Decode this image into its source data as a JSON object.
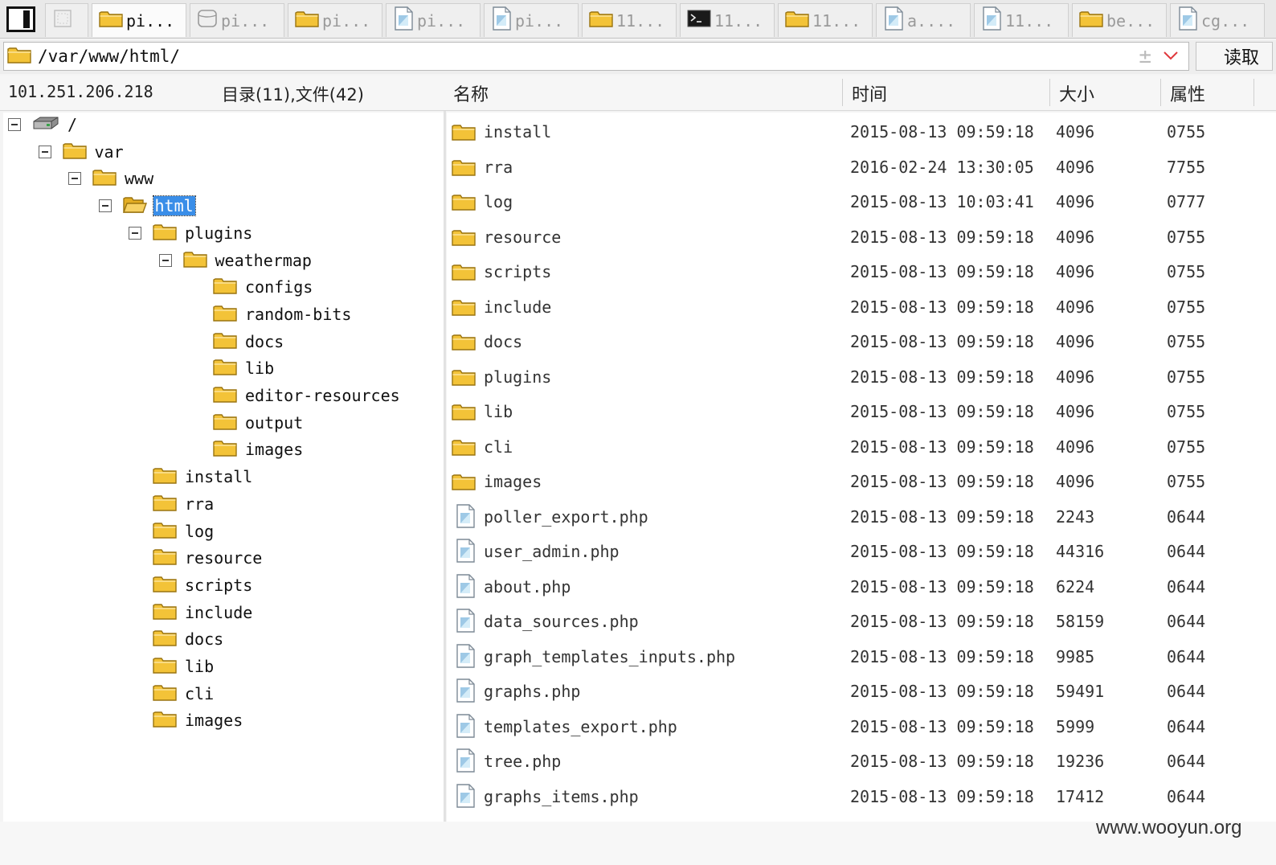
{
  "tabs": [
    {
      "label": "",
      "icon": "blank-tab-icon",
      "active": false
    },
    {
      "label": "pi...",
      "icon": "folder-icon",
      "active": true
    },
    {
      "label": "pi...",
      "icon": "database-icon",
      "active": false
    },
    {
      "label": "pi...",
      "icon": "folder-icon",
      "active": false
    },
    {
      "label": "pi...",
      "icon": "file-icon",
      "active": false
    },
    {
      "label": "pi...",
      "icon": "file-icon",
      "active": false
    },
    {
      "label": "11...",
      "icon": "folder-icon",
      "active": false
    },
    {
      "label": "11...",
      "icon": "terminal-icon",
      "active": false
    },
    {
      "label": "11...",
      "icon": "folder-icon",
      "active": false
    },
    {
      "label": "a....",
      "icon": "file-icon",
      "active": false
    },
    {
      "label": "11...",
      "icon": "file-icon",
      "active": false
    },
    {
      "label": "be...",
      "icon": "folder-icon",
      "active": false
    },
    {
      "label": "cg...",
      "icon": "file-icon",
      "active": false
    }
  ],
  "address": {
    "path": "/var/www/html/",
    "read_button": "读取"
  },
  "header": {
    "ip": "101.251.206.218",
    "counts": "目录(11),文件(42)",
    "col_name": "名称",
    "col_time": "时间",
    "col_size": "大小",
    "col_attr": "属性"
  },
  "tree": [
    {
      "label": "/",
      "icon": "drive-icon",
      "level": 0,
      "expanded": true
    },
    {
      "label": "var",
      "icon": "folder-icon",
      "level": 1,
      "expanded": true
    },
    {
      "label": "www",
      "icon": "folder-icon",
      "level": 2,
      "expanded": true
    },
    {
      "label": "html",
      "icon": "folder-open-icon",
      "level": 3,
      "expanded": true,
      "selected": true
    },
    {
      "label": "plugins",
      "icon": "folder-icon",
      "level": 4,
      "expanded": true
    },
    {
      "label": "weathermap",
      "icon": "folder-icon",
      "level": 5,
      "expanded": true
    },
    {
      "label": "configs",
      "icon": "folder-icon",
      "level": 6,
      "expanded": false
    },
    {
      "label": "random-bits",
      "icon": "folder-icon",
      "level": 6,
      "expanded": false
    },
    {
      "label": "docs",
      "icon": "folder-icon",
      "level": 6,
      "expanded": false
    },
    {
      "label": "lib",
      "icon": "folder-icon",
      "level": 6,
      "expanded": false
    },
    {
      "label": "editor-resources",
      "icon": "folder-icon",
      "level": 6,
      "expanded": false
    },
    {
      "label": "output",
      "icon": "folder-icon",
      "level": 6,
      "expanded": false
    },
    {
      "label": "images",
      "icon": "folder-icon",
      "level": 6,
      "expanded": false
    },
    {
      "label": "install",
      "icon": "folder-icon",
      "level": 4,
      "expanded": false
    },
    {
      "label": "rra",
      "icon": "folder-icon",
      "level": 4,
      "expanded": false
    },
    {
      "label": "log",
      "icon": "folder-icon",
      "level": 4,
      "expanded": false
    },
    {
      "label": "resource",
      "icon": "folder-icon",
      "level": 4,
      "expanded": false
    },
    {
      "label": "scripts",
      "icon": "folder-icon",
      "level": 4,
      "expanded": false
    },
    {
      "label": "include",
      "icon": "folder-icon",
      "level": 4,
      "expanded": false
    },
    {
      "label": "docs",
      "icon": "folder-icon",
      "level": 4,
      "expanded": false
    },
    {
      "label": "lib",
      "icon": "folder-icon",
      "level": 4,
      "expanded": false
    },
    {
      "label": "cli",
      "icon": "folder-icon",
      "level": 4,
      "expanded": false
    },
    {
      "label": "images",
      "icon": "folder-icon",
      "level": 4,
      "expanded": false
    }
  ],
  "files": [
    {
      "name": "install",
      "time": "2015-08-13 09:59:18",
      "size": "4096",
      "attr": "0755",
      "type": "folder"
    },
    {
      "name": "rra",
      "time": "2016-02-24 13:30:05",
      "size": "4096",
      "attr": "7755",
      "type": "folder"
    },
    {
      "name": "log",
      "time": "2015-08-13 10:03:41",
      "size": "4096",
      "attr": "0777",
      "type": "folder"
    },
    {
      "name": "resource",
      "time": "2015-08-13 09:59:18",
      "size": "4096",
      "attr": "0755",
      "type": "folder"
    },
    {
      "name": "scripts",
      "time": "2015-08-13 09:59:18",
      "size": "4096",
      "attr": "0755",
      "type": "folder"
    },
    {
      "name": "include",
      "time": "2015-08-13 09:59:18",
      "size": "4096",
      "attr": "0755",
      "type": "folder"
    },
    {
      "name": "docs",
      "time": "2015-08-13 09:59:18",
      "size": "4096",
      "attr": "0755",
      "type": "folder"
    },
    {
      "name": "plugins",
      "time": "2015-08-13 09:59:18",
      "size": "4096",
      "attr": "0755",
      "type": "folder"
    },
    {
      "name": "lib",
      "time": "2015-08-13 09:59:18",
      "size": "4096",
      "attr": "0755",
      "type": "folder"
    },
    {
      "name": "cli",
      "time": "2015-08-13 09:59:18",
      "size": "4096",
      "attr": "0755",
      "type": "folder"
    },
    {
      "name": "images",
      "time": "2015-08-13 09:59:18",
      "size": "4096",
      "attr": "0755",
      "type": "folder"
    },
    {
      "name": "poller_export.php",
      "time": "2015-08-13 09:59:18",
      "size": "2243",
      "attr": "0644",
      "type": "file"
    },
    {
      "name": "user_admin.php",
      "time": "2015-08-13 09:59:18",
      "size": "44316",
      "attr": "0644",
      "type": "file"
    },
    {
      "name": "about.php",
      "time": "2015-08-13 09:59:18",
      "size": "6224",
      "attr": "0644",
      "type": "file"
    },
    {
      "name": "data_sources.php",
      "time": "2015-08-13 09:59:18",
      "size": "58159",
      "attr": "0644",
      "type": "file"
    },
    {
      "name": "graph_templates_inputs.php",
      "time": "2015-08-13 09:59:18",
      "size": "9985",
      "attr": "0644",
      "type": "file"
    },
    {
      "name": "graphs.php",
      "time": "2015-08-13 09:59:18",
      "size": "59491",
      "attr": "0644",
      "type": "file"
    },
    {
      "name": "templates_export.php",
      "time": "2015-08-13 09:59:18",
      "size": "5999",
      "attr": "0644",
      "type": "file"
    },
    {
      "name": "tree.php",
      "time": "2015-08-13 09:59:18",
      "size": "19236",
      "attr": "0644",
      "type": "file"
    },
    {
      "name": "graphs_items.php",
      "time": "2015-08-13 09:59:18",
      "size": "17412",
      "attr": "0644",
      "type": "file"
    }
  ],
  "watermark": "www.wooyun.org",
  "colors": {
    "selection": "#3a8ee8",
    "folder": "#f3c338",
    "folder_edge": "#9a7410"
  }
}
